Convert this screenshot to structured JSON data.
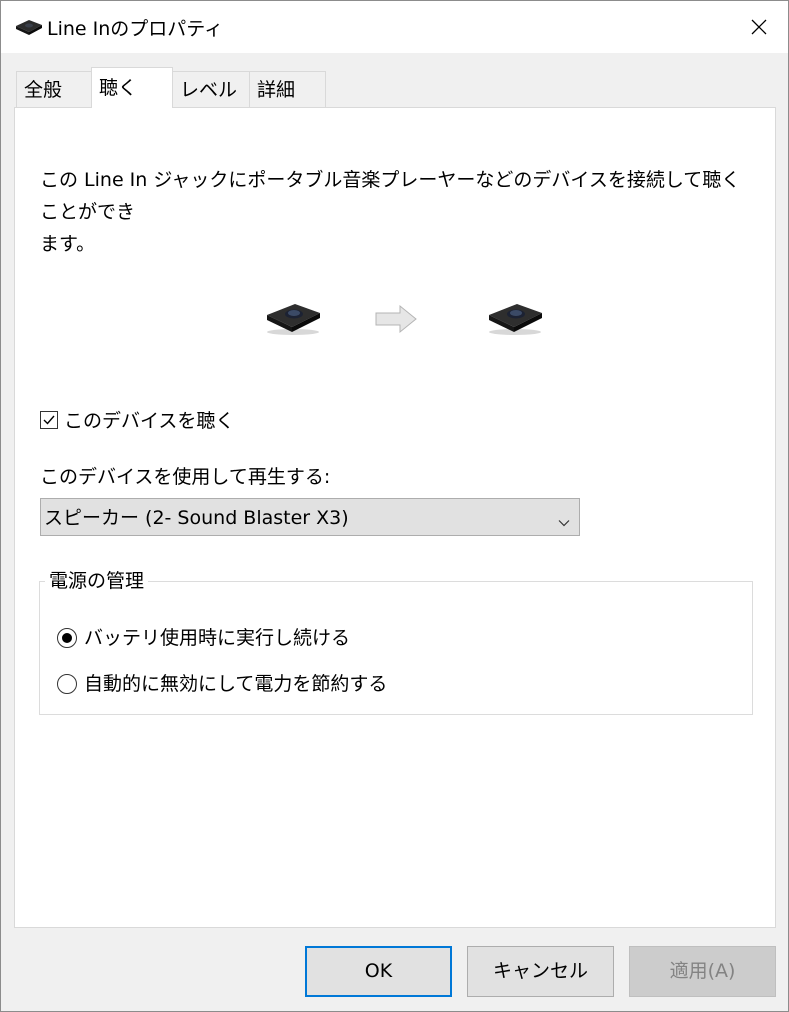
{
  "window": {
    "title": "Line Inのプロパティ",
    "icon": "sound-device-icon",
    "close_icon": "close-icon"
  },
  "tabs": [
    {
      "label": "全般",
      "active": false
    },
    {
      "label": "聴く",
      "active": true
    },
    {
      "label": "レベル",
      "active": false
    },
    {
      "label": "詳細",
      "active": false
    }
  ],
  "listen": {
    "description_line1": "この Line In ジャックにポータブル音楽プレーヤーなどのデバイスを接続して聴くことができ",
    "description_line2": "ます。",
    "listen_checkbox_label": "このデバイスを聴く",
    "listen_checked": true,
    "playback_label": "このデバイスを使用して再生する:",
    "playback_device": "スピーカー (2- Sound Blaster X3)",
    "power": {
      "legend": "電源の管理",
      "options": [
        {
          "label": "バッテリ使用時に実行し続ける",
          "selected": true
        },
        {
          "label": "自動的に無効にして電力を節約する",
          "selected": false
        }
      ]
    }
  },
  "buttons": {
    "ok": "OK",
    "cancel": "キャンセル",
    "apply": "適用(A)",
    "apply_disabled": true
  },
  "colors": {
    "dialog_bg": "#f0f0f0",
    "panel_bg": "#ffffff",
    "default_button_border": "#0078d7",
    "disabled_text": "#838383"
  }
}
